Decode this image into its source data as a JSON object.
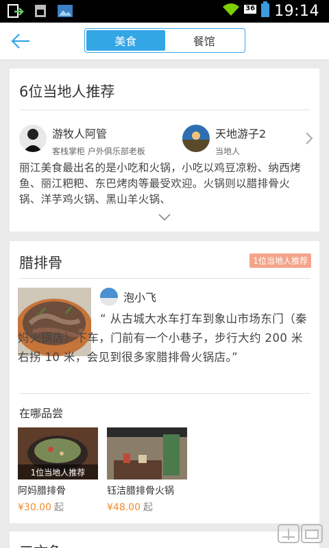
{
  "status_bar": {
    "time": "19:14",
    "network_badge": "36"
  },
  "navbar": {
    "tabs": [
      {
        "label": "美食",
        "active": true
      },
      {
        "label": "餐馆",
        "active": false
      }
    ]
  },
  "recommenders": {
    "title": "6位当地人推荐",
    "users": [
      {
        "name": "游牧人阿管",
        "desc": "客栈掌柜  户外俱乐部老板"
      },
      {
        "name": "天地游子2",
        "desc": "当地人"
      }
    ],
    "intro": "丽江美食最出名的是小吃和火锅，小吃以鸡豆凉粉、纳西烤鱼、丽江粑粑、东巴烤肉等最受欢迎。火锅则以腊排骨火锅、洋芋鸡火锅、黑山羊火锅、"
  },
  "dish": {
    "title": "腊排骨",
    "badge": "1位当地人推荐",
    "reviewer": "泡小飞",
    "quote": "“ 从古城大水车打车到象山市场东门（秦妈火锅店）下车，门前有一个小巷子，步行大约 200 米右拐 10 米，会见到很多家腊排骨火锅店。”",
    "where_label": "在哪品尝",
    "restaurants": [
      {
        "name": "阿妈腊排骨",
        "price": "¥30.00",
        "unit": "起",
        "overlay": "1位当地人推荐"
      },
      {
        "name": "钰洁腊排骨火锅",
        "price": "¥48.00",
        "unit": "起",
        "overlay": ""
      }
    ]
  },
  "next_section": {
    "title": "三文鱼"
  },
  "colors": {
    "accent": "#33a6e6",
    "price": "#f08a2a",
    "badge": "#f4a48a"
  },
  "icons": [
    "back-arrow-icon",
    "chevron-right-icon",
    "chevron-down-icon",
    "wifi-icon",
    "battery-icon"
  ]
}
